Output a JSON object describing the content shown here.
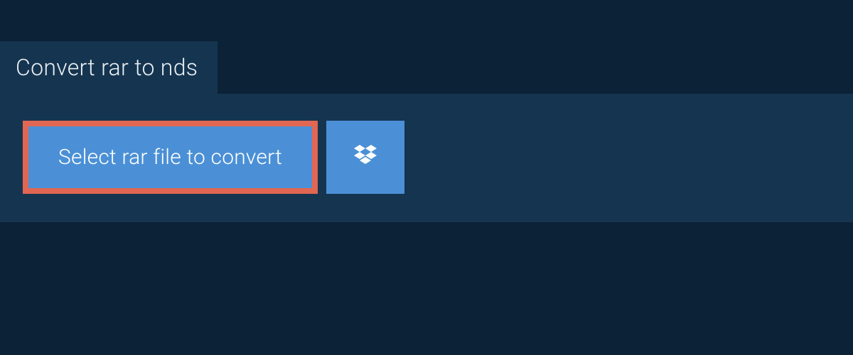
{
  "tab": {
    "title": "Convert rar to nds"
  },
  "actions": {
    "select_file_label": "Select rar file to convert"
  },
  "colors": {
    "page_bg": "#0c2237",
    "panel_bg": "#15344f",
    "button_bg": "#4b90d6",
    "highlight_border": "#e16753",
    "text_light": "#ffffff"
  }
}
